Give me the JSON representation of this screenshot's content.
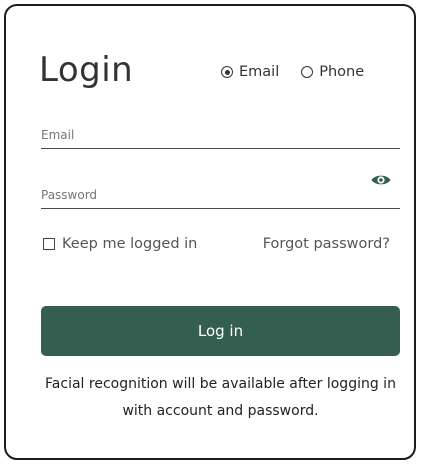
{
  "login": {
    "title": "Login",
    "method_options": [
      {
        "label": "Email",
        "selected": true
      },
      {
        "label": "Phone",
        "selected": false
      }
    ],
    "email_placeholder": "Email",
    "email_value": "",
    "password_placeholder": "Password",
    "password_value": "",
    "remember_label": "Keep me logged in",
    "remember_checked": false,
    "forgot_label": "Forgot password?",
    "submit_label": "Log in",
    "note": "Facial recognition will be available after logging in with account and password."
  },
  "icons": {
    "password_toggle": "eye-icon"
  },
  "colors": {
    "primary": "#345f50",
    "text": "#333333",
    "border": "#1c1c1c"
  }
}
